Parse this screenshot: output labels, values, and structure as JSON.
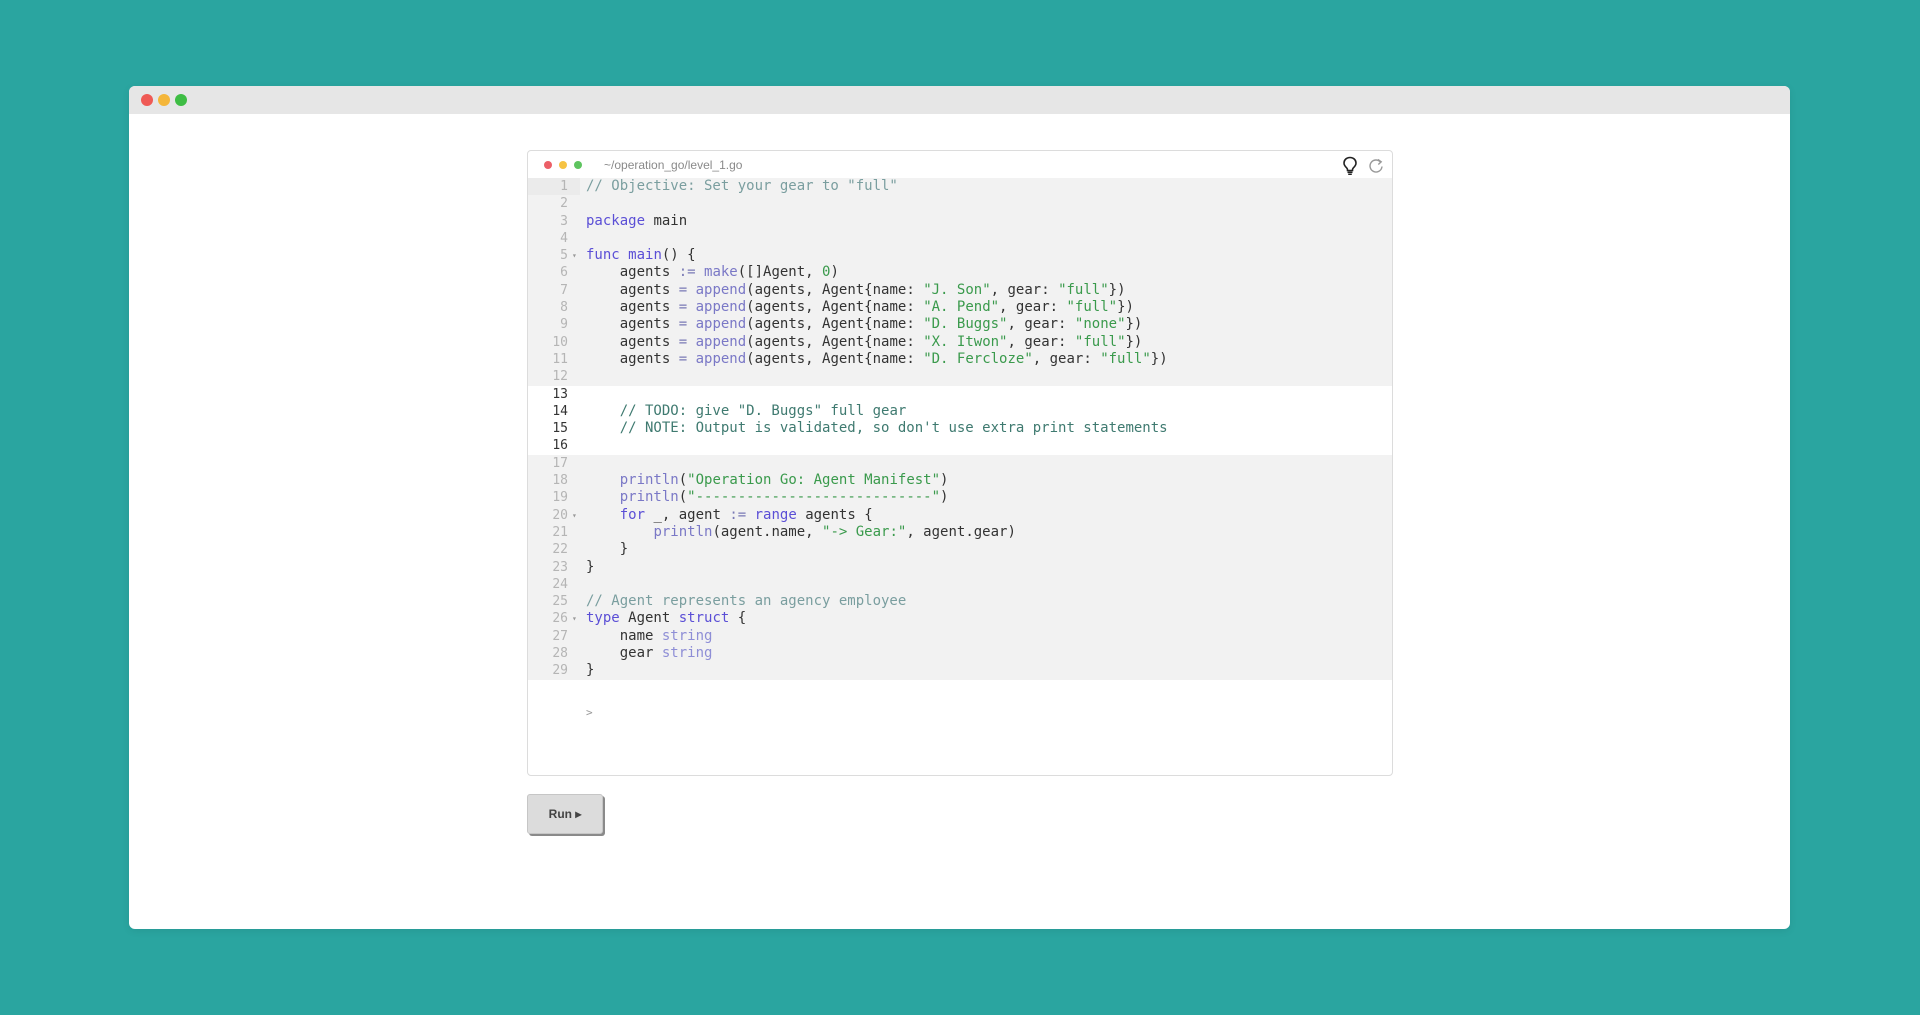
{
  "window": {
    "traffic_lights": [
      "red",
      "yellow",
      "green"
    ]
  },
  "editor": {
    "file_path": "~/operation_go/level_1.go",
    "icons": [
      "lightbulb-icon",
      "reset-icon"
    ],
    "output_prompt": ">",
    "lines": [
      {
        "n": "1",
        "locked": true,
        "fold": false,
        "html": "<span class=\"cm\">// Objective: Set your gear to \"full\"</span>"
      },
      {
        "n": "2",
        "locked": true,
        "fold": false,
        "html": ""
      },
      {
        "n": "3",
        "locked": true,
        "fold": false,
        "html": "<span class=\"kw\">package</span> main"
      },
      {
        "n": "4",
        "locked": true,
        "fold": false,
        "html": ""
      },
      {
        "n": "5",
        "locked": true,
        "fold": true,
        "html": "<span class=\"kw\">func</span> <span class=\"fn\">main</span>() {"
      },
      {
        "n": "6",
        "locked": true,
        "fold": false,
        "html": "    agents <span class=\"op\">:=</span> <span class=\"bi\">make</span>([]Agent, <span class=\"num\">0</span>)"
      },
      {
        "n": "7",
        "locked": true,
        "fold": false,
        "html": "    agents <span class=\"op\">=</span> <span class=\"bi\">append</span>(agents, Agent{name: <span class=\"str\">\"J. Son\"</span>, gear: <span class=\"str\">\"full\"</span>})"
      },
      {
        "n": "8",
        "locked": true,
        "fold": false,
        "html": "    agents <span class=\"op\">=</span> <span class=\"bi\">append</span>(agents, Agent{name: <span class=\"str\">\"A. Pend\"</span>, gear: <span class=\"str\">\"full\"</span>})"
      },
      {
        "n": "9",
        "locked": true,
        "fold": false,
        "html": "    agents <span class=\"op\">=</span> <span class=\"bi\">append</span>(agents, Agent{name: <span class=\"str\">\"D. Buggs\"</span>, gear: <span class=\"str\">\"none\"</span>})"
      },
      {
        "n": "10",
        "locked": true,
        "fold": false,
        "html": "    agents <span class=\"op\">=</span> <span class=\"bi\">append</span>(agents, Agent{name: <span class=\"str\">\"X. Itwon\"</span>, gear: <span class=\"str\">\"full\"</span>})"
      },
      {
        "n": "11",
        "locked": true,
        "fold": false,
        "html": "    agents <span class=\"op\">=</span> <span class=\"bi\">append</span>(agents, Agent{name: <span class=\"str\">\"D. Fercloze\"</span>, gear: <span class=\"str\">\"full\"</span>})"
      },
      {
        "n": "12",
        "locked": true,
        "fold": false,
        "html": ""
      },
      {
        "n": "13",
        "locked": false,
        "fold": false,
        "html": ""
      },
      {
        "n": "14",
        "locked": false,
        "fold": false,
        "html": "    <span class=\"cm2\">// TODO: give \"D. Buggs\" full gear</span>"
      },
      {
        "n": "15",
        "locked": false,
        "fold": false,
        "html": "    <span class=\"cm2\">// NOTE: Output is validated, so don't use extra print statements</span>"
      },
      {
        "n": "16",
        "locked": false,
        "fold": false,
        "html": ""
      },
      {
        "n": "17",
        "locked": true,
        "fold": false,
        "html": ""
      },
      {
        "n": "18",
        "locked": true,
        "fold": false,
        "html": "    <span class=\"bi\">println</span>(<span class=\"str\">\"Operation Go: Agent Manifest\"</span>)"
      },
      {
        "n": "19",
        "locked": true,
        "fold": false,
        "html": "    <span class=\"bi\">println</span>(<span class=\"str\">\"----------------------------\"</span>)"
      },
      {
        "n": "20",
        "locked": true,
        "fold": true,
        "html": "    <span class=\"kw\">for</span> _, agent <span class=\"op\">:=</span> <span class=\"kw\">range</span> agents {"
      },
      {
        "n": "21",
        "locked": true,
        "fold": false,
        "html": "        <span class=\"bi\">println</span>(agent.name, <span class=\"str\">\"-> Gear:\"</span>, agent.gear)"
      },
      {
        "n": "22",
        "locked": true,
        "fold": false,
        "html": "    }"
      },
      {
        "n": "23",
        "locked": true,
        "fold": false,
        "html": "}"
      },
      {
        "n": "24",
        "locked": true,
        "fold": false,
        "html": ""
      },
      {
        "n": "25",
        "locked": true,
        "fold": false,
        "html": "<span class=\"cm\">// Agent represents an agency employee</span>"
      },
      {
        "n": "26",
        "locked": true,
        "fold": true,
        "html": "<span class=\"kw\">type</span> Agent <span class=\"kw\">struct</span> {"
      },
      {
        "n": "27",
        "locked": true,
        "fold": false,
        "html": "    name <span class=\"ty\">string</span>"
      },
      {
        "n": "28",
        "locked": true,
        "fold": false,
        "html": "    gear <span class=\"ty\">string</span>"
      },
      {
        "n": "29",
        "locked": true,
        "fold": false,
        "html": "}"
      }
    ]
  },
  "run_button": {
    "label": "Run ▸"
  }
}
